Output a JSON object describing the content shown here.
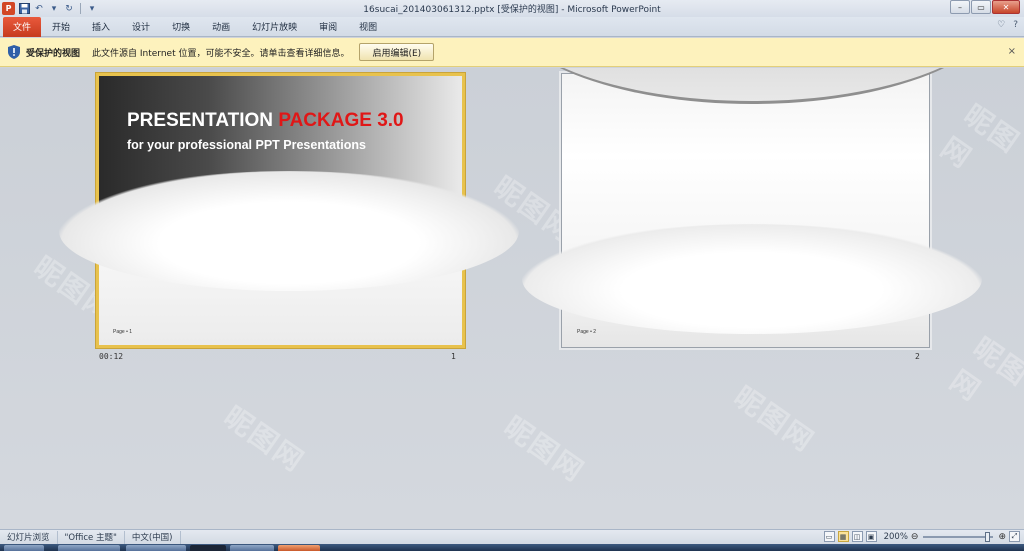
{
  "window": {
    "title": "16sucai_201403061312.pptx [受保护的视图]  -  Microsoft PowerPoint",
    "app_icon_letter": "P",
    "controls": {
      "minimize": "–",
      "restore": "▭",
      "close": "✕"
    }
  },
  "qat": {
    "save_icon": "save-icon",
    "undo": "↶",
    "redo": "↻",
    "customize": "▾"
  },
  "ribbon": {
    "tabs": [
      "文件",
      "开始",
      "插入",
      "设计",
      "切换",
      "动画",
      "幻灯片放映",
      "审阅",
      "视图"
    ],
    "right": {
      "minimize_glyph": "♡",
      "help_glyph": "?"
    }
  },
  "protected_view": {
    "title": "受保护的视图",
    "message": "此文件源自 Internet 位置，可能不安全。请单击查看详细信息。",
    "enable_button": "启用编辑(E)",
    "close": "×"
  },
  "slides": [
    {
      "number": "1",
      "timing": "00:12",
      "title_white": "PRESENTATION ",
      "title_red": "PACKAGE 3.0",
      "subtitle": "for your professional PPT Presentations",
      "page_label": "Page • 1",
      "selected": true
    },
    {
      "number": "2",
      "timing": "",
      "page_label": "Page • 2",
      "selected": false
    }
  ],
  "watermark_text": "昵图网",
  "statusbar": {
    "view_name": "幻灯片浏览",
    "theme": "\"Office 主题\"",
    "language": "中文(中国)",
    "zoom": "200%",
    "zoom_minus": "⊖",
    "zoom_plus": "⊕"
  },
  "colors": {
    "accent_red": "#e01717",
    "selection": "#e8c24d",
    "file_tab": "#c63b1f",
    "message_bar": "#fdf2bd"
  }
}
